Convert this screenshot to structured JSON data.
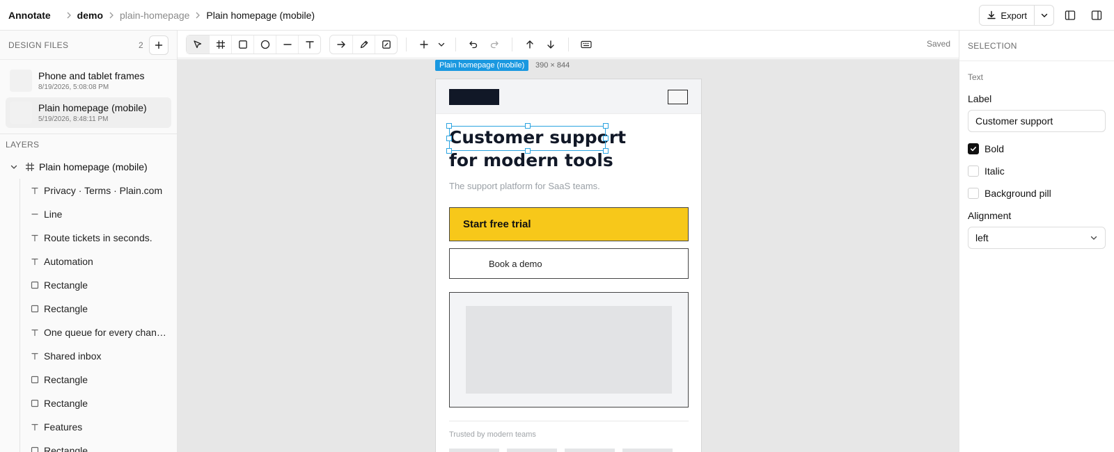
{
  "topbar": {
    "brand": "Annotate",
    "breadcrumb": [
      "demo",
      "plain-homepage",
      "Plain homepage (mobile)"
    ],
    "export_label": "Export"
  },
  "files": {
    "header": "DESIGN FILES",
    "count": "2",
    "items": [
      {
        "name": "Phone and tablet frames",
        "date": "8/19/2026, 5:08:08 PM"
      },
      {
        "name": "Plain homepage (mobile)",
        "date": "5/19/2026, 8:48:11 PM"
      }
    ]
  },
  "layers": {
    "header": "LAYERS",
    "frame": "Plain homepage (mobile)",
    "items": [
      {
        "type": "text",
        "label": "Privacy · Terms · Plain.com"
      },
      {
        "type": "line",
        "label": "Line"
      },
      {
        "type": "text",
        "label": "Route tickets in seconds."
      },
      {
        "type": "text",
        "label": "Automation"
      },
      {
        "type": "rect",
        "label": "Rectangle"
      },
      {
        "type": "rect",
        "label": "Rectangle"
      },
      {
        "type": "text",
        "label": "One queue for every chan…"
      },
      {
        "type": "text",
        "label": "Shared inbox"
      },
      {
        "type": "rect",
        "label": "Rectangle"
      },
      {
        "type": "rect",
        "label": "Rectangle"
      },
      {
        "type": "text",
        "label": "Features"
      },
      {
        "type": "rect",
        "label": "Rectangle"
      }
    ]
  },
  "toolbar": {
    "status": "Saved",
    "tools": [
      "select-icon",
      "frame-icon",
      "rectangle-icon",
      "ellipse-icon",
      "line-icon",
      "text-icon",
      "arrow-icon",
      "pen-icon",
      "note-icon",
      "plus-icon",
      "undo-icon",
      "redo-icon",
      "bring-forward-icon",
      "send-backward-icon",
      "keyboard-icon"
    ]
  },
  "canvas": {
    "frame_tag": "Plain homepage (mobile)",
    "frame_size": "390 × 844",
    "hero_line1": "Customer support",
    "hero_line2": "for modern tools",
    "subtitle": "The support platform for SaaS teams.",
    "cta": "Start free trial",
    "secondary": "Book a demo",
    "trusted": "Trusted by modern teams"
  },
  "selection": {
    "header": "SELECTION",
    "type": "Text",
    "label_title": "Label",
    "label_value": "Customer support",
    "bold": "Bold",
    "italic": "Italic",
    "pill": "Background pill",
    "alignment_title": "Alignment",
    "alignment_value": "left"
  },
  "colors": {
    "accent": "#1a98e0",
    "cta_yellow": "#f7c81a",
    "dark": "#111827"
  }
}
